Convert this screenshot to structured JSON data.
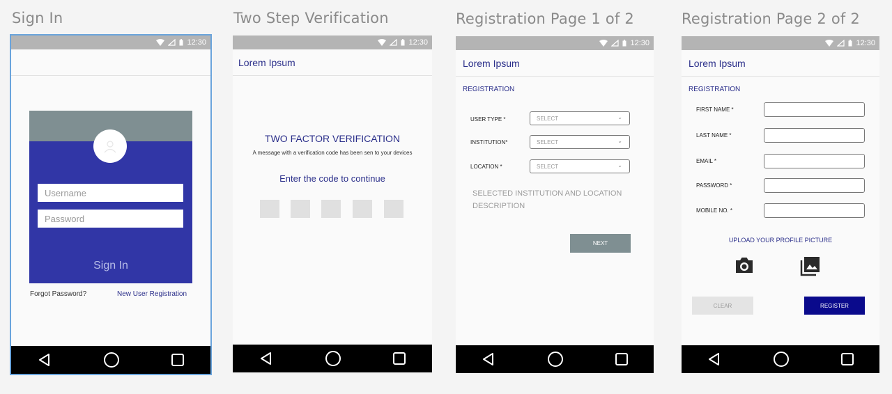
{
  "status_time": "12:30",
  "app_title": "Lorem Ipsum",
  "screens": {
    "sign_in": {
      "title": "Sign In",
      "username_placeholder": "Username",
      "password_placeholder": "Password",
      "button": "Sign In",
      "forgot": "Forgot Password?",
      "new_user": "New User Registration"
    },
    "two_step": {
      "title": "Two Step Verification",
      "heading": "TWO FACTOR VERIFICATION",
      "message": "A message with a verification code has been sen to your devices",
      "prompt": "Enter the code to continue"
    },
    "reg1": {
      "title": "Registration Page 1 of 2",
      "section": "REGISTRATION",
      "user_type_label": "USER TYPE *",
      "institution_label": "INSTITUTION*",
      "location_label": "LOCATION *",
      "select_text": "SELECT",
      "description": "SELECTED INSTITUTION AND LOCATION DESCRIPTION",
      "next": "NEXT"
    },
    "reg2": {
      "title": "Registration Page 2 of 2",
      "section": "REGISTRATION",
      "first_name": "FIRST NAME *",
      "last_name": "LAST NAME *",
      "email": "EMAIL *",
      "password": "PASSWORD *",
      "mobile": "MOBILE NO. *",
      "upload": "UPLOAD YOUR PROFILE PICTURE",
      "clear": "CLEAR",
      "register": "REGISTER"
    }
  },
  "colors": {
    "primary": "#3136a6",
    "accent_text": "#2b2f8a",
    "header_gray": "#7f8f92",
    "register_blue": "#0a0a8c"
  }
}
